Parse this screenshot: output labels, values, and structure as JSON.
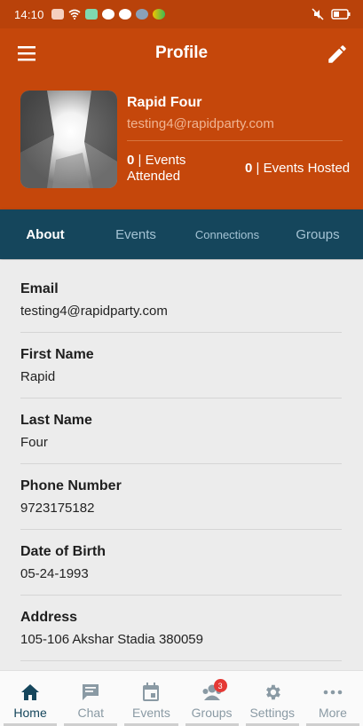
{
  "status_bar": {
    "time": "14:10"
  },
  "app_bar": {
    "title": "Profile"
  },
  "profile": {
    "name": "Rapid Four",
    "email": "testing4@rapidparty.com",
    "events_attended_count": "0",
    "events_attended_label": "| Events Attended",
    "events_hosted_count": "0",
    "events_hosted_label": "| Events Hosted"
  },
  "tabs": [
    {
      "label": "About",
      "active": true
    },
    {
      "label": "Events",
      "active": false
    },
    {
      "label": "Connections",
      "active": false
    },
    {
      "label": "Groups",
      "active": false
    }
  ],
  "fields": [
    {
      "label": "Email",
      "value": "testing4@rapidparty.com"
    },
    {
      "label": "First Name",
      "value": "Rapid"
    },
    {
      "label": "Last Name",
      "value": "Four"
    },
    {
      "label": "Phone Number",
      "value": "9723175182"
    },
    {
      "label": "Date of Birth",
      "value": "05-24-1993"
    },
    {
      "label": "Address",
      "value": "105-106 Akshar Stadia 380059"
    }
  ],
  "bottom_nav": [
    {
      "label": "Home",
      "icon": "home-icon",
      "active": true
    },
    {
      "label": "Chat",
      "icon": "chat-icon",
      "active": false
    },
    {
      "label": "Events",
      "icon": "calendar-icon",
      "active": false
    },
    {
      "label": "Groups",
      "icon": "groups-icon",
      "active": false,
      "badge": "3"
    },
    {
      "label": "Settings",
      "icon": "gear-icon",
      "active": false
    },
    {
      "label": "More",
      "icon": "more-icon",
      "active": false
    }
  ],
  "colors": {
    "header": "#c5470b",
    "tab_bar": "#15465c",
    "badge": "#e53935"
  }
}
